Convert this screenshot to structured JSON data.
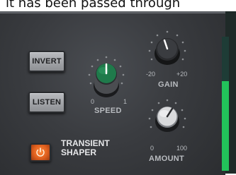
{
  "caption": "it has been passed through",
  "buttons": {
    "invert": "INVERT",
    "listen": "LISTEN"
  },
  "speed": {
    "label": "SPEED",
    "min": "0",
    "max": "1",
    "knob_color": "#1f7a4b",
    "value": 0.5
  },
  "gain": {
    "label": "GAIN",
    "min": "-20",
    "max": "+20",
    "value": 0.45
  },
  "amount": {
    "label": "AMOUNT",
    "min": "0",
    "max": "100",
    "value": 0.6
  },
  "transient": {
    "line1": "TRANSIENT",
    "line2": "SHAPER",
    "power_color": "#ff7a2e"
  },
  "meter": {
    "level": 0.67,
    "color": "#22c25a"
  },
  "icons": {
    "power": "power-icon"
  }
}
